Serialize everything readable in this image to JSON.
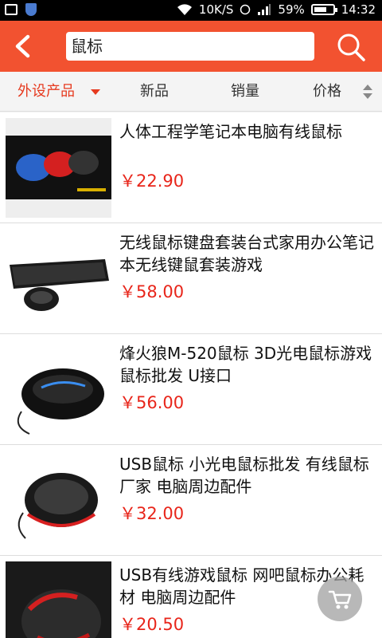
{
  "status_bar": {
    "network_speed": "10K/S",
    "battery_percent": "59%",
    "time": "14:32",
    "icons": [
      "screenshot-icon",
      "shield-icon",
      "wifi-icon",
      "alarm-icon",
      "signal-icon",
      "battery-icon"
    ]
  },
  "header": {
    "back_icon": "chevron-left-icon",
    "search_value": "鼠标",
    "search_icon": "search-icon",
    "accent_color": "#f25230"
  },
  "filters": {
    "tabs": [
      {
        "label": "外设产品",
        "active": true
      },
      {
        "label": "新品"
      },
      {
        "label": "销量"
      },
      {
        "label": "价格"
      }
    ]
  },
  "products": [
    {
      "title": "人体工程学笔记本电脑有线鼠标",
      "price": "￥22.90"
    },
    {
      "title": "无线鼠标键盘套装台式家用办公笔记本无线键鼠套装游戏",
      "price": "￥58.00"
    },
    {
      "title": "烽火狼M-520鼠标 3D光电鼠标游戏鼠标批发 U接口",
      "price": "￥56.00"
    },
    {
      "title": "USB鼠标 小光电鼠标批发 有线鼠标厂家 电脑周边配件",
      "price": "￥32.00"
    },
    {
      "title": "USB有线游戏鼠标 网吧鼠标办公耗材 电脑周边配件",
      "price": "￥20.50"
    }
  ],
  "cart_button": {
    "icon": "cart-icon"
  }
}
